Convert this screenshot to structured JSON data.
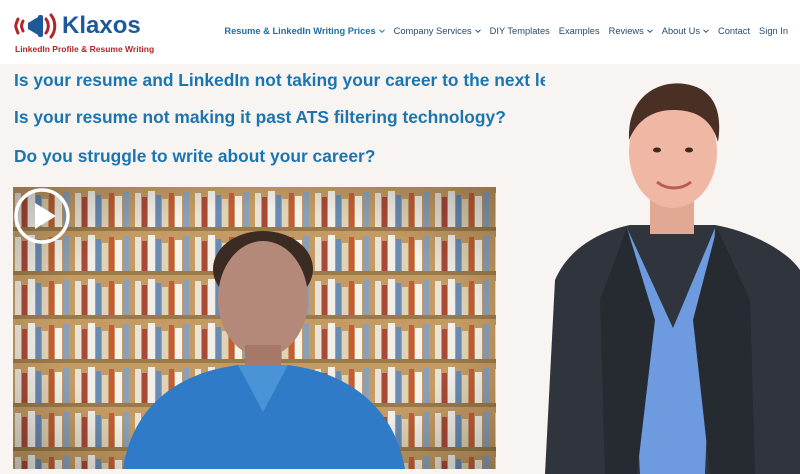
{
  "brand": {
    "name": "Klaxos",
    "tagline": "LinkedIn Profile & Resume Writing"
  },
  "nav": {
    "items": [
      {
        "label": "Resume & LinkedIn Writing Prices",
        "dropdown": true,
        "active": true
      },
      {
        "label": "Company Services",
        "dropdown": true
      },
      {
        "label": "DIY Templates",
        "dropdown": false
      },
      {
        "label": "Examples",
        "dropdown": false
      },
      {
        "label": "Reviews",
        "dropdown": true
      },
      {
        "label": "About Us",
        "dropdown": true
      },
      {
        "label": "Contact",
        "dropdown": false
      },
      {
        "label": "Sign In",
        "dropdown": false
      }
    ]
  },
  "hero": {
    "headlines": [
      "Is your resume and LinkedIn not taking your career to the next level?",
      "Is your resume not making it past ATS filtering technology?",
      "Do you struggle to write about your career?"
    ]
  },
  "colors": {
    "brand_blue": "#1e5a9a",
    "headline_blue": "#1b76b0",
    "brand_red": "#b3242a",
    "nav_text": "#2a4a6d"
  },
  "icons": {
    "play": "play-icon",
    "chevron": "chevron-down-icon",
    "logo": "megaphone-logo-icon"
  }
}
